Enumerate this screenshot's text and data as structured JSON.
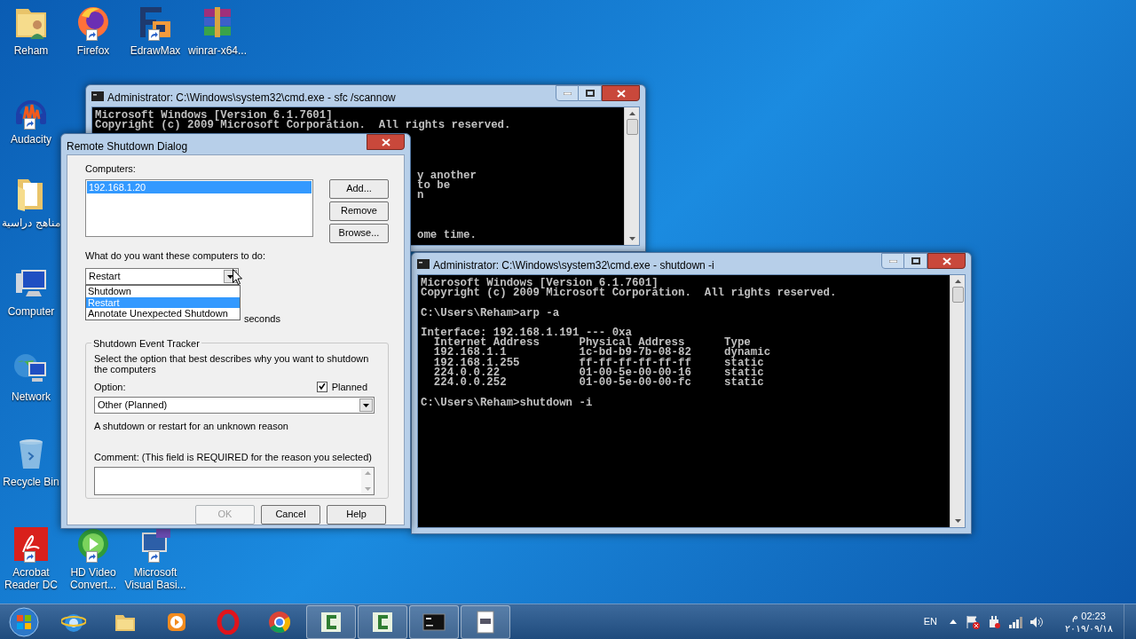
{
  "desktop_icons": [
    {
      "label": "Reham",
      "kind": "user_folder",
      "shortcut": false
    },
    {
      "label": "Firefox",
      "kind": "firefox",
      "shortcut": true
    },
    {
      "label": "EdrawMax",
      "kind": "edraw",
      "shortcut": true
    },
    {
      "label": "winrar-x64...",
      "kind": "archive",
      "shortcut": false
    },
    {
      "label": "Audacity",
      "kind": "audio",
      "shortcut": true
    },
    {
      "label": "مناهج دراسية",
      "kind": "folder",
      "shortcut": false
    },
    {
      "label": "Computer",
      "kind": "computer",
      "shortcut": false
    },
    {
      "label": "Network",
      "kind": "network",
      "shortcut": false
    },
    {
      "label": "Recycle Bin",
      "kind": "recycle",
      "shortcut": false
    },
    {
      "label": "Acrobat Reader DC",
      "kind": "pdf",
      "shortcut": true
    },
    {
      "label": "HD Video Convert...",
      "kind": "video",
      "shortcut": true
    },
    {
      "label": "Microsoft Visual Basi...",
      "kind": "vb",
      "shortcut": true
    }
  ],
  "console_windows": [
    {
      "title": "Administrator: C:\\Windows\\system32\\cmd.exe - sfc  /scannow",
      "blocks": [
        [
          "Microsoft Windows [Version 6.1.7601]",
          "Copyright (c) 2009 Microsoft Corporation.  All rights reserved."
        ],
        [
          "y another",
          "to be",
          "n"
        ],
        [
          "ome time."
        ]
      ]
    },
    {
      "title": "Administrator: C:\\Windows\\system32\\cmd.exe - shutdown  -i",
      "blocks": [
        [
          "Microsoft Windows [Version 6.1.7601]",
          "Copyright (c) 2009 Microsoft Corporation.  All rights reserved."
        ],
        [
          "C:\\Users\\Reham>arp -a"
        ],
        [
          "Interface: 192.168.1.191 --- 0xa",
          "  Internet Address      Physical Address      Type",
          "  192.168.1.1           1c-bd-b9-7b-08-82     dynamic",
          "  192.168.1.255         ff-ff-ff-ff-ff-ff     static",
          "  224.0.0.22            01-00-5e-00-00-16     static",
          "  224.0.0.252           01-00-5e-00-00-fc     static"
        ],
        [
          "C:\\Users\\Reham>shutdown -i"
        ]
      ]
    }
  ],
  "dialog": {
    "title": "Remote Shutdown Dialog",
    "computers_label": "Computers:",
    "computers": [
      {
        "text": "192.168.1.20",
        "selected": true
      }
    ],
    "side_buttons": [
      "Add...",
      "Remove",
      "Browse..."
    ],
    "action_label": "What do you want these computers to do:",
    "action_value": "Restart",
    "action_open": true,
    "action_options": [
      {
        "text": "Shutdown",
        "selected": false
      },
      {
        "text": "Restart",
        "selected": true
      },
      {
        "text": "Annotate Unexpected Shutdown",
        "selected": false
      }
    ],
    "warning_unit": "seconds",
    "tracker": {
      "title": "Shutdown Event Tracker",
      "description": "Select the option that best describes why you want to shutdown the computers",
      "option_label": "Option:",
      "planned": {
        "label": "Planned",
        "checked": true
      },
      "option_value": "Other (Planned)",
      "reason": "A shutdown or restart for an unknown reason",
      "comment_label": "Comment: (This field is REQUIRED for the reason you selected)"
    },
    "buttons": [
      {
        "label": "OK",
        "disabled": true
      },
      {
        "label": "Cancel",
        "disabled": false
      },
      {
        "label": "Help",
        "disabled": false
      }
    ]
  },
  "taskbar": {
    "items": [
      {
        "kind": "ie",
        "running": false
      },
      {
        "kind": "explorer",
        "running": false
      },
      {
        "kind": "media",
        "running": false
      },
      {
        "kind": "opera",
        "running": false
      },
      {
        "kind": "chrome",
        "running": false
      },
      {
        "kind": "camtasia",
        "running": true
      },
      {
        "kind": "camtasia",
        "running": true
      },
      {
        "kind": "console",
        "running": true
      },
      {
        "kind": "document",
        "running": true
      }
    ],
    "language": "EN",
    "clock": {
      "time": "02:23 م",
      "date": "٢٠١٩/٠٩/١٨"
    }
  }
}
